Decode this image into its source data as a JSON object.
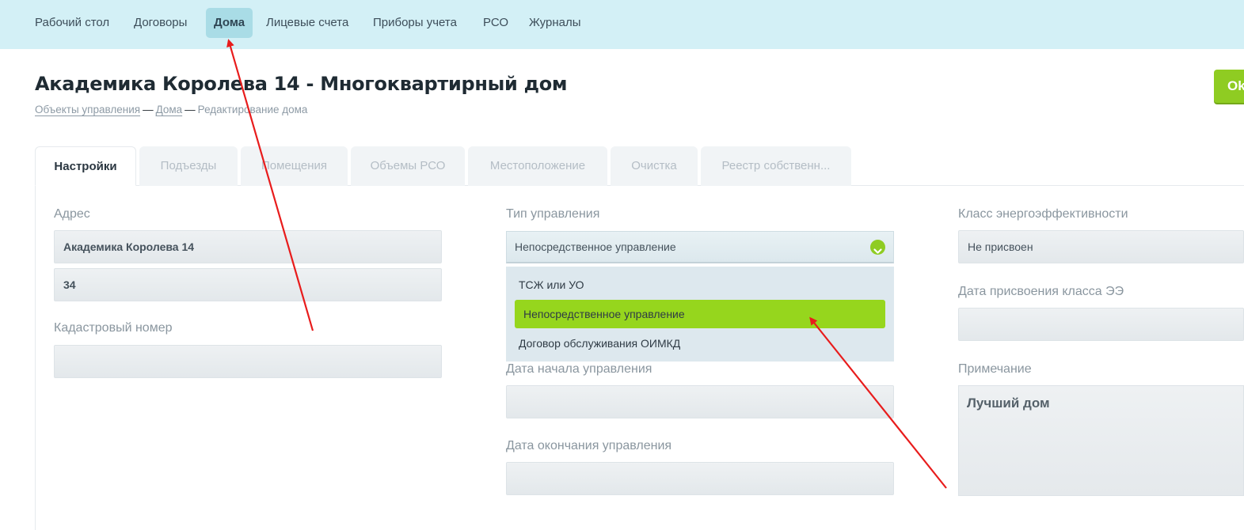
{
  "nav": {
    "items": [
      {
        "label": "Рабочий стол"
      },
      {
        "label": "Договоры"
      },
      {
        "label": "Дома",
        "active": true
      },
      {
        "label": "Лицевые счета"
      },
      {
        "label": "Приборы учета"
      },
      {
        "label": "РСО"
      },
      {
        "label": "Журналы"
      }
    ]
  },
  "header": {
    "title": "Академика Королева 14 - Многоквартирный дом",
    "save_label": "Ok",
    "breadcrumb": [
      {
        "label": "Объекты управления",
        "link": true
      },
      {
        "label": "Дома",
        "link": true
      },
      {
        "label": "Редактирование дома",
        "link": false
      }
    ],
    "separator": "—"
  },
  "tabs": [
    {
      "label": "Настройки",
      "active": true
    },
    {
      "label": "Подъезды"
    },
    {
      "label": "Помещения"
    },
    {
      "label": "Объемы РСО"
    },
    {
      "label": "Местоположение"
    },
    {
      "label": "Очистка"
    },
    {
      "label": "Реестр собственн..."
    }
  ],
  "form": {
    "address_label": "Адрес",
    "address_value": "Академика Королева 14",
    "address_number": "34",
    "cadastral_label": "Кадастровый номер",
    "cadastral_value": "",
    "management_type_label": "Тип управления",
    "management_type_value": "Непосредственное управление",
    "management_type_options": [
      {
        "label": "ТСЖ или УО"
      },
      {
        "label": "Непосредственное управление",
        "selected": true
      },
      {
        "label": "Договор обслуживания ОИМКД"
      }
    ],
    "start_date_label": "Дата начала управления",
    "start_date_value": "",
    "end_date_label": "Дата окончания управления",
    "end_date_value": "",
    "energy_class_label": "Класс энергоэффективности",
    "energy_class_value": "Не присвоен",
    "energy_class_date_label": "Дата присвоения класса ЭЭ",
    "energy_class_date_value": "",
    "note_label": "Примечание",
    "note_value": "Лучший дом"
  },
  "colors": {
    "nav_bg": "#d3f0f6",
    "accent_green": "#8fcc22",
    "annotation_red": "#e81c1c"
  }
}
